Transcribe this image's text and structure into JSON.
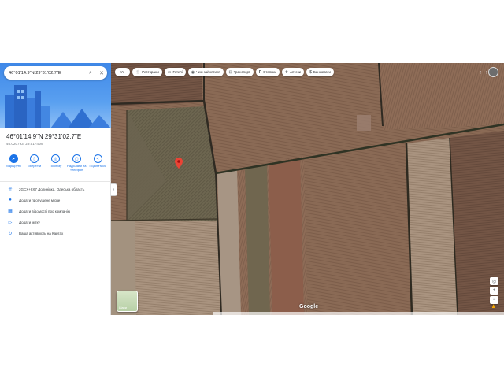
{
  "search": {
    "query": "46°01'14.9\"N 29°31'02.7\"E"
  },
  "place": {
    "title": "46°01'14.9\"N 29°31'02.7\"E",
    "decimal": "46.020793, 29.517408"
  },
  "actions": [
    {
      "label": "Маршрути",
      "icon": "directions-icon"
    },
    {
      "label": "Зберегти",
      "icon": "bookmark-icon"
    },
    {
      "label": "Поблизу",
      "icon": "nearby-icon"
    },
    {
      "label": "Надіслати на телефон",
      "icon": "send-to-phone-icon"
    },
    {
      "label": "Поділитися",
      "icon": "share-icon"
    }
  ],
  "info": [
    {
      "text": "2GCX+8X7 Долинівка, Одеська область",
      "icon": "plus-code-icon"
    },
    {
      "text": "Додати пропущене місце",
      "icon": "add-place-icon"
    },
    {
      "text": "Додати відомості про компанію",
      "icon": "add-business-icon"
    },
    {
      "text": "Додати мітку",
      "icon": "label-icon"
    },
    {
      "text": "Ваша активність на Картах",
      "icon": "history-icon"
    }
  ],
  "chips": [
    {
      "label": "Ресторани",
      "icon": "restaurant-icon"
    },
    {
      "label": "Готелі",
      "icon": "hotel-icon"
    },
    {
      "label": "Чим зайнятися",
      "icon": "attractions-icon"
    },
    {
      "label": "Транспорт",
      "icon": "transit-icon"
    },
    {
      "label": "Стоянки",
      "icon": "parking-icon"
    },
    {
      "label": "Аптеки",
      "icon": "pharmacy-icon"
    },
    {
      "label": "Банкомати",
      "icon": "atm-icon"
    }
  ],
  "chip_menu": {
    "label": "Ук"
  },
  "layers": {
    "label": "Шари"
  },
  "google": {
    "label": "Google"
  },
  "colors": {
    "accent": "#1a73e8",
    "pin": "#ea4335"
  }
}
